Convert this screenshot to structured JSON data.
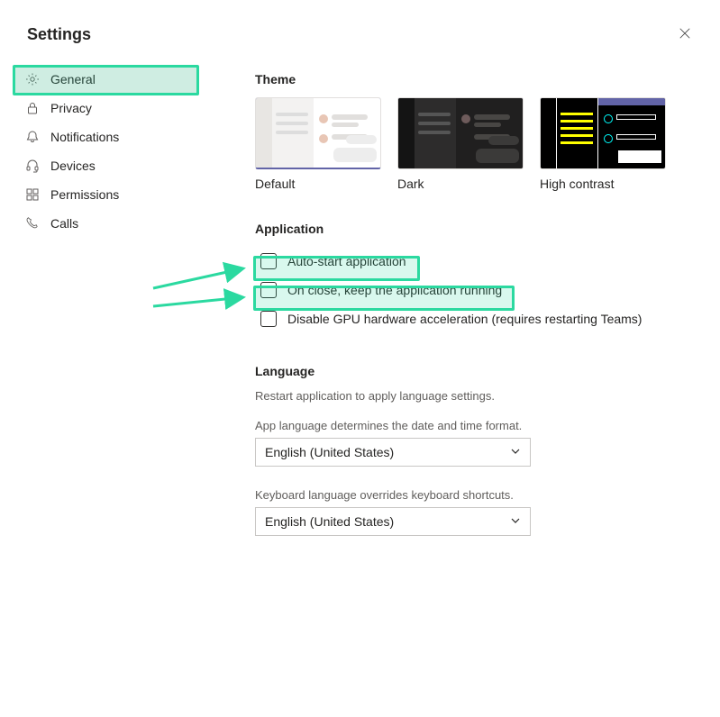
{
  "title": "Settings",
  "sidebar": {
    "items": [
      {
        "label": "General",
        "icon": "gear-icon",
        "active": true
      },
      {
        "label": "Privacy",
        "icon": "lock-icon",
        "active": false
      },
      {
        "label": "Notifications",
        "icon": "bell-icon",
        "active": false
      },
      {
        "label": "Devices",
        "icon": "headset-icon",
        "active": false
      },
      {
        "label": "Permissions",
        "icon": "apps-icon",
        "active": false
      },
      {
        "label": "Calls",
        "icon": "phone-icon",
        "active": false
      }
    ]
  },
  "theme": {
    "heading": "Theme",
    "options": [
      {
        "label": "Default",
        "selected": true
      },
      {
        "label": "Dark",
        "selected": false
      },
      {
        "label": "High contrast",
        "selected": false
      }
    ]
  },
  "application": {
    "heading": "Application",
    "options": [
      {
        "label": "Auto-start application",
        "checked": false
      },
      {
        "label": "On close, keep the application running",
        "checked": false
      },
      {
        "label": "Disable GPU hardware acceleration (requires restarting Teams)",
        "checked": false
      }
    ]
  },
  "language": {
    "heading": "Language",
    "restart_note": "Restart application to apply language settings.",
    "app_lang_desc": "App language determines the date and time format.",
    "app_lang_value": "English (United States)",
    "kb_lang_desc": "Keyboard language overrides keyboard shortcuts.",
    "kb_lang_value": "English (United States)"
  },
  "annotation_color": "#2bd9a0"
}
